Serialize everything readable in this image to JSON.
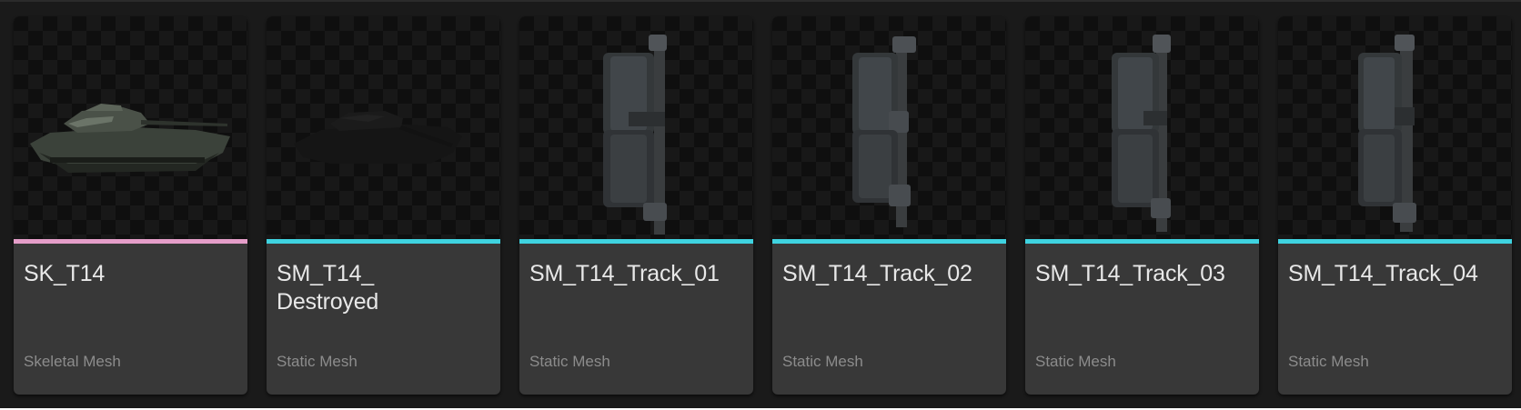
{
  "colors": {
    "skeletal_mesh": "#e59ec9",
    "static_mesh": "#3fd3e0"
  },
  "assets": [
    {
      "name_line1": "SK_T14",
      "name_line2": "",
      "type": "Skeletal Mesh",
      "type_color": "#e59ec9",
      "thumbnail_icon": "tank-mesh-icon"
    },
    {
      "name_line1": "SM_T14_",
      "name_line2": "Destroyed",
      "type": "Static Mesh",
      "type_color": "#3fd3e0",
      "thumbnail_icon": "destroyed-tank-mesh-icon"
    },
    {
      "name_line1": "SM_T14_Track_01",
      "name_line2": "",
      "type": "Static Mesh",
      "type_color": "#3fd3e0",
      "thumbnail_icon": "track-link-mesh-icon"
    },
    {
      "name_line1": "SM_T14_Track_02",
      "name_line2": "",
      "type": "Static Mesh",
      "type_color": "#3fd3e0",
      "thumbnail_icon": "track-link-mesh-icon"
    },
    {
      "name_line1": "SM_T14_Track_03",
      "name_line2": "",
      "type": "Static Mesh",
      "type_color": "#3fd3e0",
      "thumbnail_icon": "track-link-mesh-icon"
    },
    {
      "name_line1": "SM_T14_Track_04",
      "name_line2": "",
      "type": "Static Mesh",
      "type_color": "#3fd3e0",
      "thumbnail_icon": "track-link-mesh-icon"
    }
  ]
}
